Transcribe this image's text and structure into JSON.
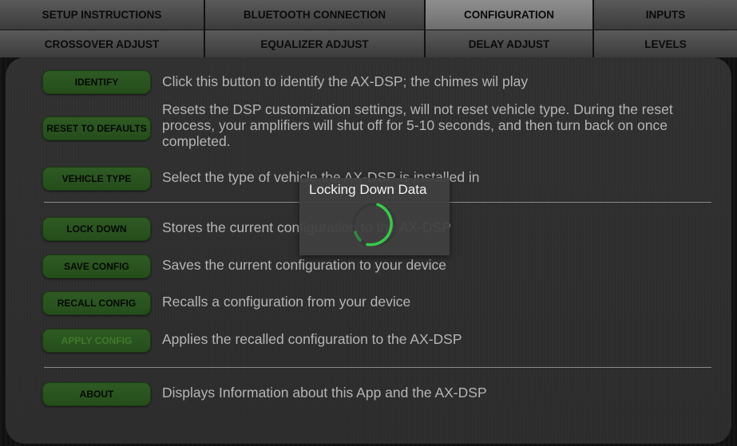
{
  "tabs_row1": [
    "SETUP INSTRUCTIONS",
    "BLUETOOTH CONNECTION",
    "CONFIGURATION",
    "INPUTS"
  ],
  "tabs_row2": [
    "CROSSOVER ADJUST",
    "EQUALIZER ADJUST",
    "DELAY ADJUST",
    "LEVELS"
  ],
  "active_tab": "CONFIGURATION",
  "buttons": {
    "identify": {
      "label": "IDENTIFY",
      "desc": "Click this button to identify the AX-DSP; the chimes wil play"
    },
    "reset": {
      "label": "RESET TO DEFAULTS",
      "desc": "Resets the DSP customization settings, will not reset vehicle type. During the reset process, your amplifiers will shut off for 5-10 seconds, and then turn back on once completed."
    },
    "vehicle_type": {
      "label": "VEHICLE TYPE",
      "desc": "Select the type of vehicle the AX-DSP is installed in"
    },
    "lock_down": {
      "label": "LOCK DOWN",
      "desc": "Stores the current configuration to the AX-DSP"
    },
    "save_config": {
      "label": "SAVE CONFIG",
      "desc": "Saves the current configuration to your device"
    },
    "recall_config": {
      "label": "RECALL CONFIG",
      "desc": "Recalls a configuration from your device"
    },
    "apply_config": {
      "label": "APPLY CONFIG",
      "desc": "Applies the recalled configuration to the AX-DSP",
      "enabled": false
    },
    "about": {
      "label": "ABOUT",
      "desc": "Displays Information about this App and the AX-DSP"
    }
  },
  "dialog": {
    "title": "Locking Down Data",
    "icon": "loading-spinner-icon"
  },
  "colors": {
    "button_green": "#2f5b23",
    "spinner_green": "#34c94a",
    "text": "#b5b5b5"
  }
}
